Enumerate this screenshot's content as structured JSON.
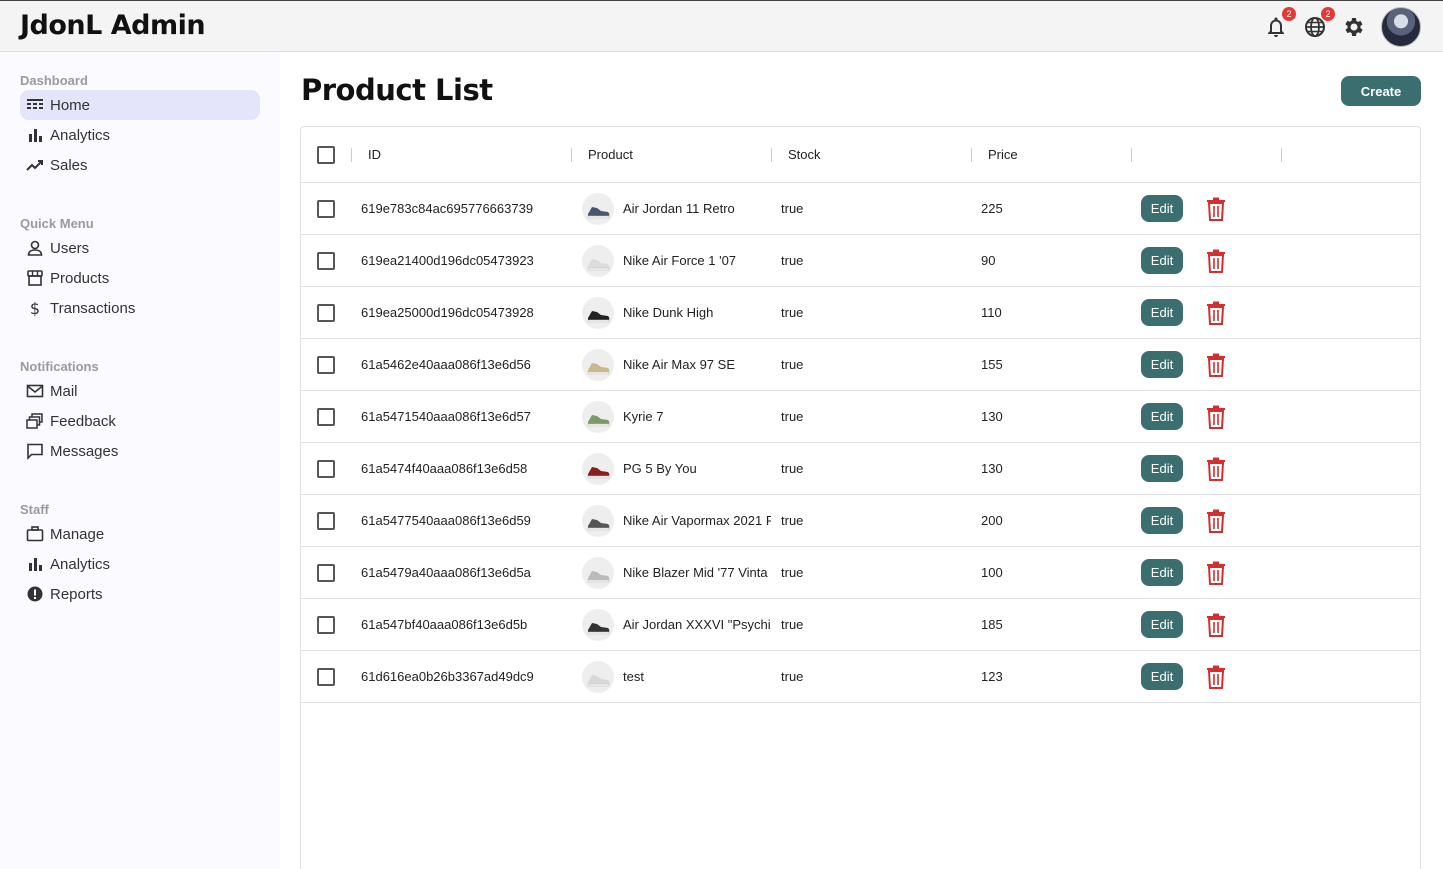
{
  "app": {
    "title": "JdonL Admin"
  },
  "topbar": {
    "notification_count": "2",
    "language_count": "2",
    "icons": [
      "bell-icon",
      "globe-icon",
      "gear-icon",
      "avatar"
    ]
  },
  "sidebar": {
    "sections": [
      {
        "title": "Dashboard",
        "items": [
          {
            "label": "Home",
            "icon": "home-icon",
            "active": true
          },
          {
            "label": "Analytics",
            "icon": "bar-chart-icon"
          },
          {
            "label": "Sales",
            "icon": "trending-up-icon"
          }
        ]
      },
      {
        "title": "Quick Menu",
        "items": [
          {
            "label": "Users",
            "icon": "user-icon"
          },
          {
            "label": "Products",
            "icon": "store-icon"
          },
          {
            "label": "Transactions",
            "icon": "dollar-icon"
          }
        ]
      },
      {
        "title": "Notifications",
        "items": [
          {
            "label": "Mail",
            "icon": "mail-icon"
          },
          {
            "label": "Feedback",
            "icon": "feedback-icon"
          },
          {
            "label": "Messages",
            "icon": "chat-icon"
          }
        ]
      },
      {
        "title": "Staff",
        "items": [
          {
            "label": "Manage",
            "icon": "briefcase-icon"
          },
          {
            "label": "Analytics",
            "icon": "bar-chart-icon"
          },
          {
            "label": "Reports",
            "icon": "report-icon"
          }
        ]
      }
    ]
  },
  "main": {
    "title": "Product List",
    "create_label": "Create",
    "columns": [
      "ID",
      "Product",
      "Stock",
      "Price"
    ],
    "edit_label": "Edit",
    "rows": [
      {
        "id": "619e783c84ac695776663739",
        "product": "Air Jordan 11 Retro",
        "stock": "true",
        "price": "225",
        "shoe": "#4a5670"
      },
      {
        "id": "619ea21400d196dc05473923",
        "product": "Nike Air Force 1 '07",
        "stock": "true",
        "price": "90",
        "shoe": "#dcdcdc"
      },
      {
        "id": "619ea25000d196dc05473928",
        "product": "Nike Dunk High",
        "stock": "true",
        "price": "110",
        "shoe": "#222222"
      },
      {
        "id": "61a5462e40aaa086f13e6d56",
        "product": "Nike Air Max 97 SE",
        "stock": "true",
        "price": "155",
        "shoe": "#c9b88a"
      },
      {
        "id": "61a5471540aaa086f13e6d57",
        "product": "Kyrie 7",
        "stock": "true",
        "price": "130",
        "shoe": "#7a9a6a"
      },
      {
        "id": "61a5474f40aaa086f13e6d58",
        "product": "PG 5 By You",
        "stock": "true",
        "price": "130",
        "shoe": "#8b1e1e"
      },
      {
        "id": "61a5477540aaa086f13e6d59",
        "product": "Nike Air Vapormax 2021 F",
        "stock": "true",
        "price": "200",
        "shoe": "#555555"
      },
      {
        "id": "61a5479a40aaa086f13e6d5a",
        "product": "Nike Blazer Mid '77 Vinta",
        "stock": "true",
        "price": "100",
        "shoe": "#bbbbbb"
      },
      {
        "id": "61a547bf40aaa086f13e6d5b",
        "product": "Air Jordan XXXVI \"Psychi",
        "stock": "true",
        "price": "185",
        "shoe": "#333333"
      },
      {
        "id": "61d616ea0b26b3367ad49dc9",
        "product": "test",
        "stock": "true",
        "price": "123",
        "shoe": "#d8d8d8"
      }
    ]
  },
  "colors": {
    "accent": "#3b6f6f",
    "active_nav": "#e4e4fa",
    "delete": "#d32f2f",
    "badge": "#e53935"
  }
}
